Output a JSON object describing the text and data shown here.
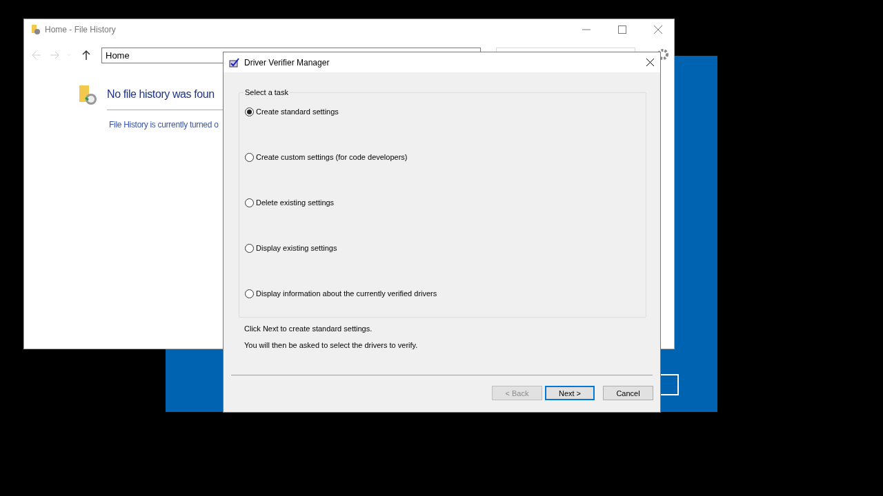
{
  "file_history_window": {
    "title": "Home - File History",
    "address": "Home",
    "heading": "No file history was foun",
    "status_link": "File History is currently turned o"
  },
  "dialog": {
    "title": "Driver Verifier Manager",
    "group_label": "Select a task",
    "options": [
      {
        "label": "Create standard settings",
        "selected": true
      },
      {
        "label": "Create custom settings (for code developers)",
        "selected": false
      },
      {
        "label": "Delete existing settings",
        "selected": false
      },
      {
        "label": "Display existing settings",
        "selected": false
      },
      {
        "label": "Display information about the currently verified drivers",
        "selected": false
      }
    ],
    "hints": [
      "Click Next to create standard settings.",
      "You will then be asked to select the drivers to verify."
    ],
    "buttons": [
      {
        "label": "< Back",
        "disabled": true,
        "default": false
      },
      {
        "label": "Next >",
        "disabled": false,
        "default": true
      },
      {
        "label": "Cancel",
        "disabled": false,
        "default": false
      }
    ]
  }
}
